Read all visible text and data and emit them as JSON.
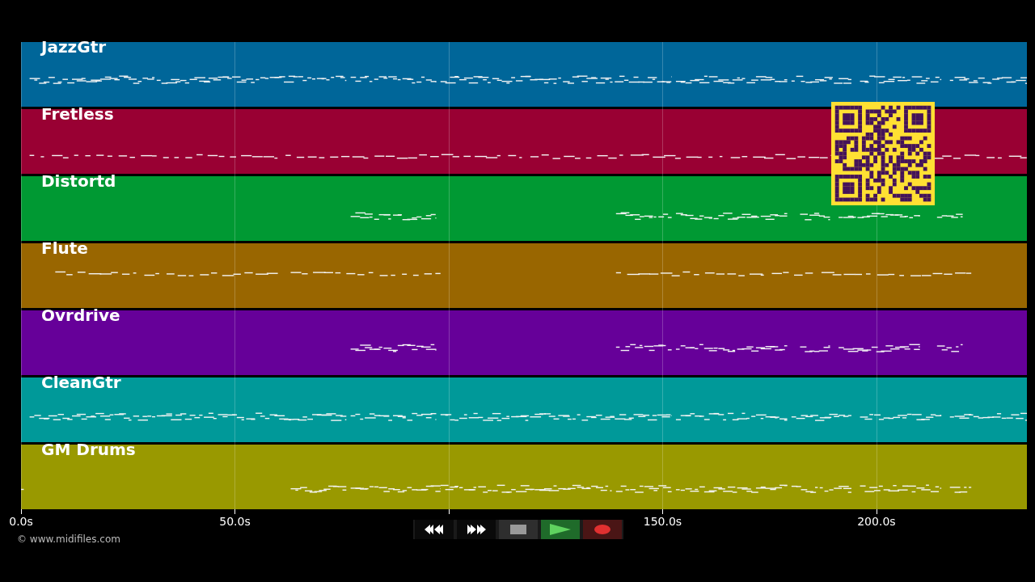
{
  "tracks": [
    {
      "name": "JazzGtr",
      "color": "#006699"
    },
    {
      "name": "Fretless",
      "color": "#990033"
    },
    {
      "name": "Distortd",
      "color": "#009933"
    },
    {
      "name": "Flute",
      "color": "#996600"
    },
    {
      "name": "Ovrdrive",
      "color": "#660099"
    },
    {
      "name": "CleanGtr",
      "color": "#009999"
    },
    {
      "name": "GM Drums",
      "color": "#999900"
    }
  ],
  "axis": {
    "ticks": [
      "0.0s",
      "50.0s",
      "150.0s",
      "200.0s"
    ]
  },
  "credit": "© www.midifiles.com"
}
